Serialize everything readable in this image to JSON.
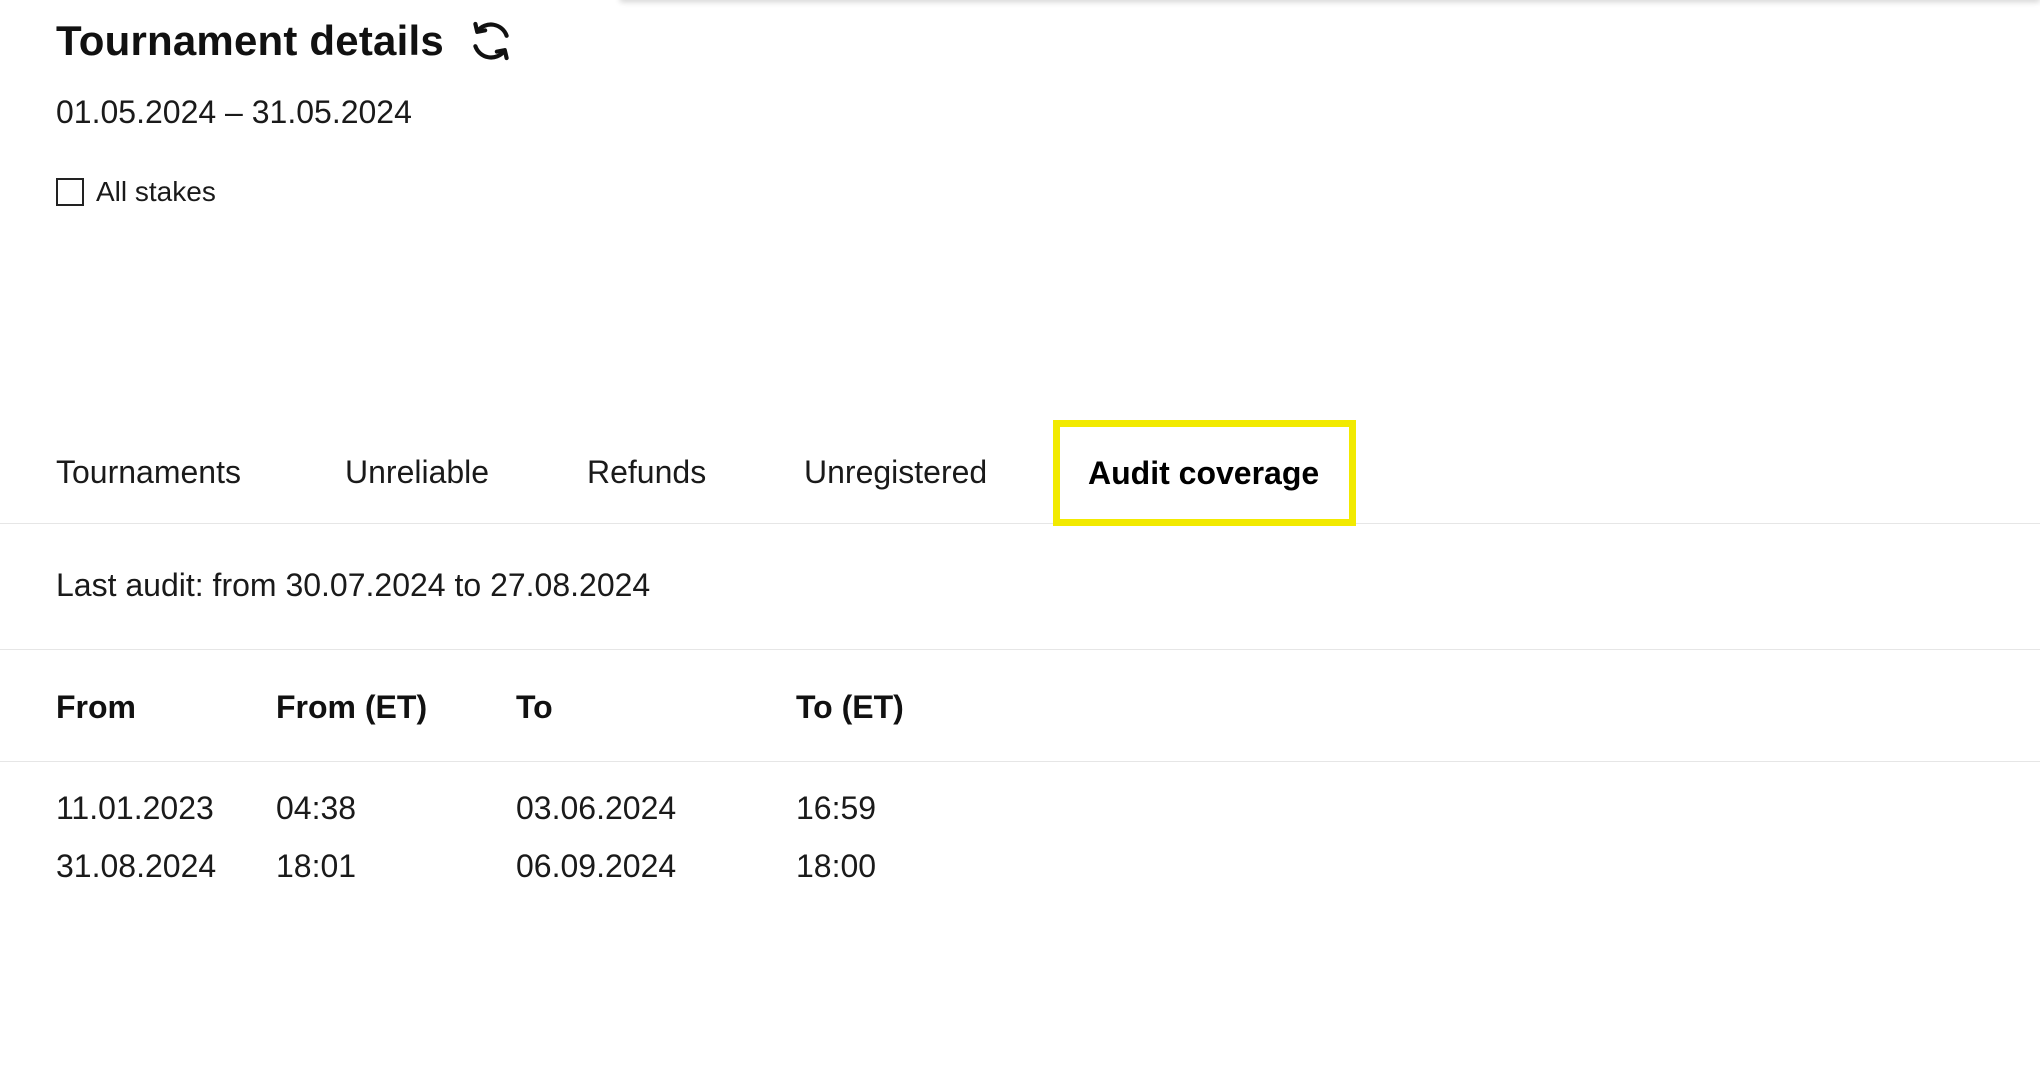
{
  "header": {
    "title": "Tournament details",
    "refresh_icon": "refresh-icon"
  },
  "date_range": "01.05.2024 – 31.05.2024",
  "filter": {
    "all_stakes_label": "All stakes",
    "all_stakes_checked": false
  },
  "tabs": [
    {
      "label": "Tournaments",
      "active": false
    },
    {
      "label": "Unreliable",
      "active": false
    },
    {
      "label": "Refunds",
      "active": false
    },
    {
      "label": "Unregistered",
      "active": false
    },
    {
      "label": "Audit coverage",
      "active": true
    }
  ],
  "highlight_color": "#f2ea00",
  "last_audit": "Last audit: from 30.07.2024 to 27.08.2024",
  "table": {
    "columns": [
      "From",
      "From (ET)",
      "To",
      "To (ET)"
    ],
    "rows": [
      [
        "11.01.2023",
        "04:38",
        "03.06.2024",
        "16:59"
      ],
      [
        "31.08.2024",
        "18:01",
        "06.09.2024",
        "18:00"
      ]
    ]
  }
}
